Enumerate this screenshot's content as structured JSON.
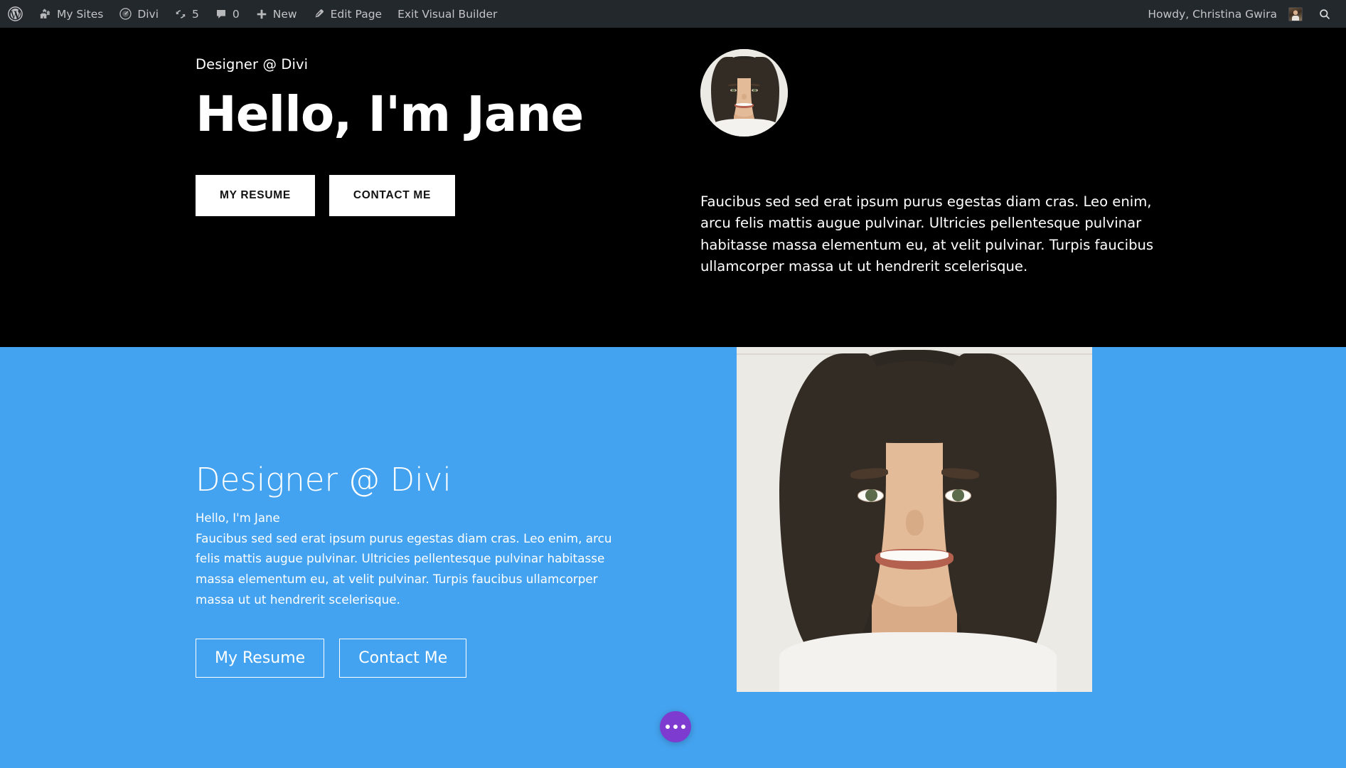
{
  "adminbar": {
    "wp_logo": "wordpress-logo-icon",
    "items": [
      {
        "icon": "wordpress-logo-icon",
        "label": ""
      },
      {
        "icon": "my-sites-icon",
        "label": "My Sites"
      },
      {
        "icon": "divi-dashboard-icon",
        "label": "Divi"
      },
      {
        "icon": "updates-icon",
        "label": "5"
      },
      {
        "icon": "comments-icon",
        "label": "0"
      },
      {
        "icon": "plus-icon",
        "label": "New"
      },
      {
        "icon": "pencil-icon",
        "label": "Edit Page"
      },
      {
        "icon": "",
        "label": "Exit Visual Builder"
      }
    ],
    "my_sites": "My Sites",
    "divi": "Divi",
    "updates_count": "5",
    "comments_count": "0",
    "new": "New",
    "edit_page": "Edit Page",
    "exit_visual_builder": "Exit Visual Builder",
    "howdy": "Howdy, Christina Gwira",
    "search": "search-icon",
    "bg_color": "#23282d",
    "text_color": "#c3c4c7"
  },
  "hero": {
    "eyebrow": "Designer @ Divi",
    "title": "Hello, I'm Jane",
    "buttons": [
      {
        "label": "MY RESUME",
        "name": "my-resume"
      },
      {
        "label": "CONTACT ME",
        "name": "contact-me"
      }
    ],
    "resume_label": "MY RESUME",
    "contact_label": "CONTACT ME",
    "paragraph": "Faucibus sed sed erat ipsum purus egestas diam cras. Leo enim, arcu felis mattis augue pulvinar. Ultricies pellentesque pulvinar habitasse massa elementum eu, at velit pulvinar. Turpis faucibus ullamcorper massa ut ut hendrerit scelerisque.",
    "bg_color": "#000000",
    "text_color": "#ffffff",
    "button_bg": "#ffffff",
    "button_text": "#111111",
    "avatar": "profile-photo"
  },
  "blue_section": {
    "heading": "Designer @ Divi",
    "subheading": "Hello, I'm Jane",
    "paragraph": "Faucibus sed sed erat ipsum purus egestas diam cras. Leo enim, arcu felis mattis augue pulvinar. Ultricies pellentesque pulvinar habitasse massa elementum eu, at velit pulvinar. Turpis faucibus ullamcorper massa ut ut hendrerit scelerisque.",
    "resume_label": "My Resume",
    "contact_label": "Contact Me",
    "bg_color": "#44a3f0",
    "text_color": "#ffffff",
    "photo": "portrait-photo"
  },
  "fab": {
    "label": "divi-builder-menu",
    "color": "#7e3bd0",
    "icon": "three-dots-icon"
  }
}
